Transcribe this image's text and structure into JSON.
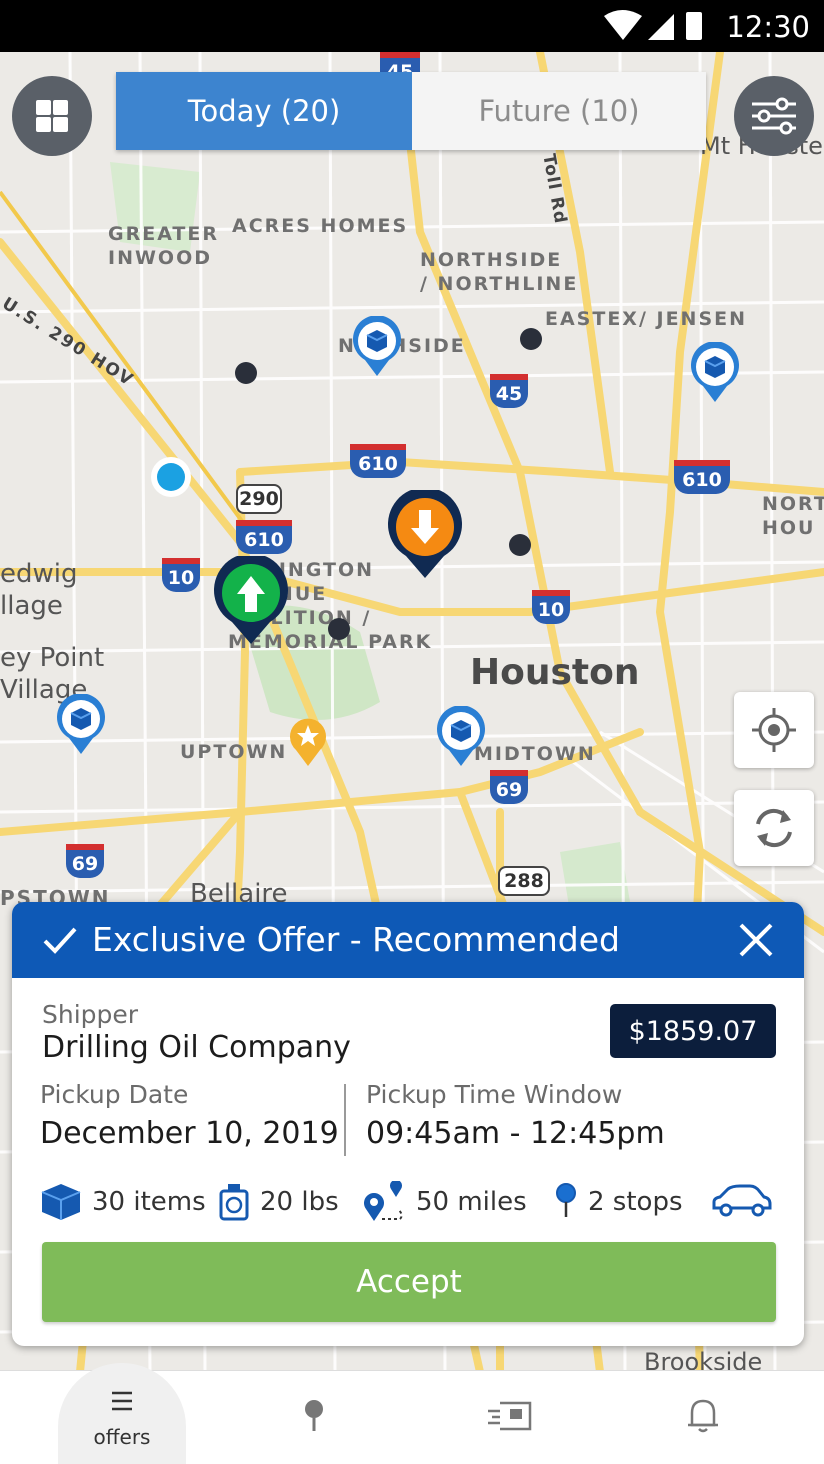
{
  "status_bar": {
    "time": "12:30"
  },
  "tabs": {
    "today": "Today (20)",
    "future": "Future (10)"
  },
  "map": {
    "labels": {
      "greater_inwood": "GREATER\nINWOOD",
      "acres_homes": "ACRES HOMES",
      "northside_northline": "NORTHSIDE\n/ NORTHLINE",
      "eastex_jensen": "EASTEX/ JENSEN",
      "northside": "N    HSIDE",
      "washington_avenue": "  SHINGTON\n  VENUE\n   ALITION /\nMEMORIAL PARK",
      "uptown": "UPTOWN",
      "midtown": "MIDTOWN",
      "houston": "Houston",
      "mt_houston": "Mt H  uste",
      "north_houston": "NORT\nHOU",
      "us290": "U.S. 290 HOV",
      "toll_rd": "Toll Rd",
      "spring_branch": "edwig\nllage",
      "hunters_creek": "ey Point\nVillage",
      "bellaire": "Bellaire",
      "westpstown": "PSTOWN",
      "brookside": "Brookside"
    },
    "highways": [
      "45",
      "45",
      "610",
      "610",
      "610",
      "290",
      "10",
      "10",
      "69",
      "69",
      "288"
    ]
  },
  "offer": {
    "header": "Exclusive Offer - Recommended",
    "shipper_label": "Shipper",
    "shipper": "Drilling Oil Company",
    "price": "$1859.07",
    "pickup_date_label": "Pickup Date",
    "pickup_date": "December  10, 2019",
    "pickup_window_label": "Pickup Time Window",
    "pickup_window": "09:45am - 12:45pm",
    "items": "30 items",
    "weight": "20 lbs",
    "distance": "50 miles",
    "stops": "2 stops",
    "accept": "Accept"
  },
  "nav": {
    "offers": "offers"
  },
  "colors": {
    "header_blue": "#0e59b6",
    "accept_green": "#7fbb59",
    "tab_active": "#3d84cf",
    "price_bg": "#0c1e3c"
  }
}
